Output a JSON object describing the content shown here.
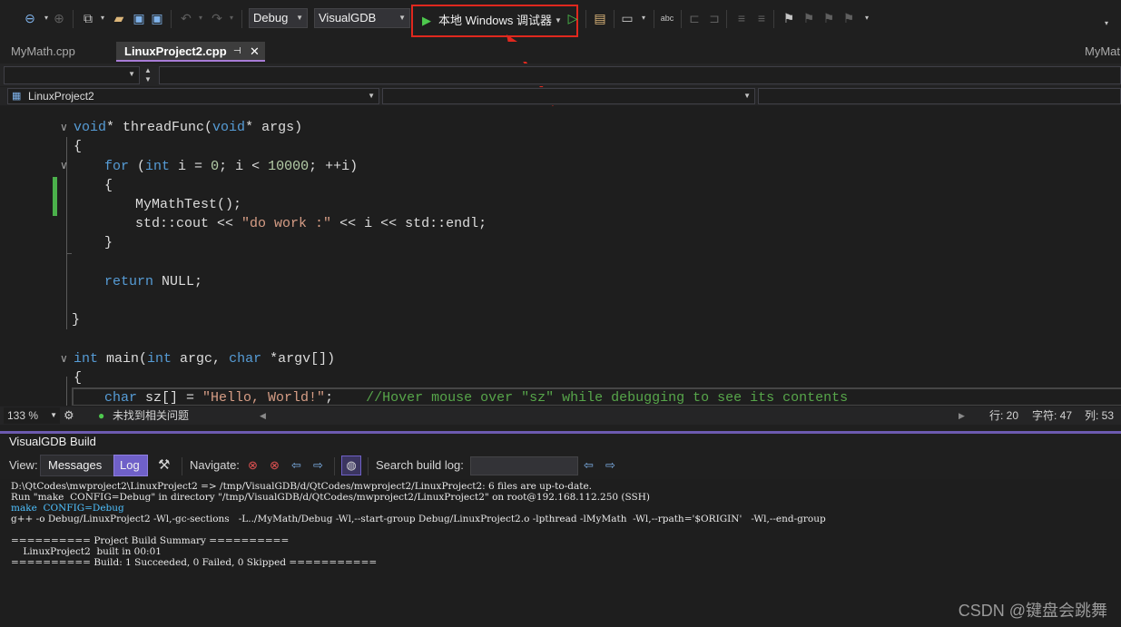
{
  "toolbar": {
    "config": "Debug",
    "platform": "VisualGDB",
    "run_label": "本地 Windows 调试器"
  },
  "tabs": [
    {
      "label": "MyMath.cpp"
    },
    {
      "label": "LinuxProject2.cpp"
    },
    {
      "label": "MyMat"
    }
  ],
  "nav": {
    "project": "LinuxProject2"
  },
  "code": {
    "l1_kw": "void",
    "l1_rest": "* threadFunc(",
    "l1_kw2": "void",
    "l1_end": "* args)",
    "l2": "{",
    "l3_kw": "for",
    "l3_a": " (",
    "l3_kw2": "int",
    "l3_b": " i = ",
    "l3_n1": "0",
    "l3_c": "; i < ",
    "l3_n2": "10000",
    "l3_d": "; ++i)",
    "l4": "{",
    "l5": "MyMathTest();",
    "l6_a": "std::cout << ",
    "l6_str": "\"do work :\"",
    "l6_b": " << i << std::endl;",
    "l7": "}",
    "l8_kw": "return",
    "l8_rest": " NULL;",
    "l9": "}",
    "l10_kw": "int",
    "l10_a": " main(",
    "l10_kw2": "int",
    "l10_b": " argc, ",
    "l10_kw3": "char",
    "l10_c": " *argv[])",
    "l11": "{",
    "l12_kw": "char",
    "l12_a": " sz[] = ",
    "l12_str": "\"Hello, World!\"",
    "l12_b": ";    ",
    "l12_cm": "//Hover mouse over \"sz\" while debugging to see its contents"
  },
  "status": {
    "zoom": "133 %",
    "issues": "未找到相关问题",
    "line": "行: 20",
    "char": "字符: 47",
    "col": "列: 53"
  },
  "panel": {
    "title": "VisualGDB Build",
    "view_label": "View:",
    "messages": "Messages",
    "log": "Log",
    "navigate_label": "Navigate:",
    "search_label": "Search build log:",
    "search_value": ""
  },
  "output": [
    "D:\\QtCodes\\mwproject2\\LinuxProject2 => /tmp/VisualGDB/d/QtCodes/mwproject2/LinuxProject2: 6 files are up-to-date.",
    "Run \"make  CONFIG=Debug\" in directory \"/tmp/VisualGDB/d/QtCodes/mwproject2/LinuxProject2\" on root@192.168.112.250 (SSH)",
    "make  CONFIG=Debug",
    "g++ -o Debug/LinuxProject2 -Wl,-gc-sections   -L../MyMath/Debug -Wl,--start-group Debug/LinuxProject2.o -lpthread -lMyMath  -Wl,--rpath='$ORIGIN'   -Wl,--end-group",
    "",
    "========== Project Build Summary ==========",
    "    LinuxProject2  built in 00:01",
    "========== Build: 1 Succeeded, 0 Failed, 0 Skipped ==========="
  ],
  "watermark": "CSDN @键盘会跳舞"
}
